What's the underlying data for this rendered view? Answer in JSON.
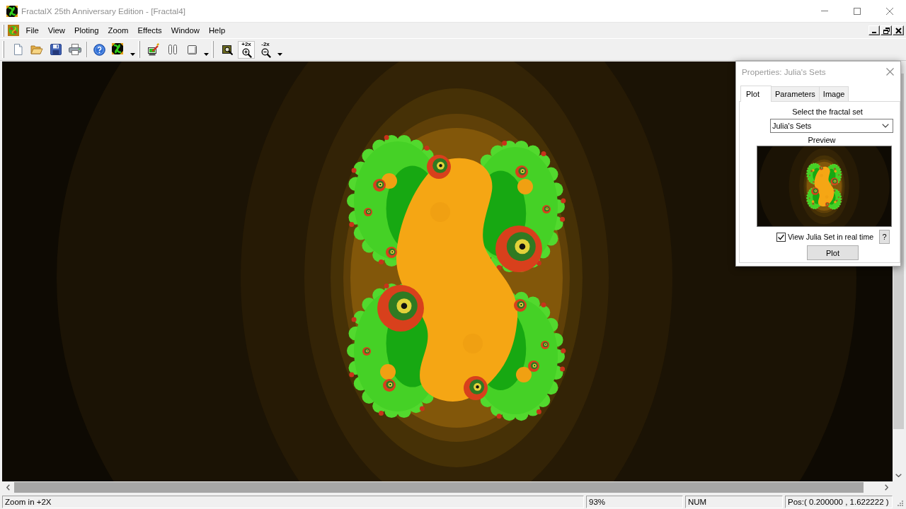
{
  "window": {
    "title": "FractalX 25th Anniversary Edition - [Fractal4]"
  },
  "menu": [
    "File",
    "View",
    "Ploting",
    "Zoom",
    "Effects",
    "Window",
    "Help"
  ],
  "toolbar": [
    [
      [
        {
          "kind": "new",
          "selected": false
        },
        {
          "kind": "open",
          "selected": false
        },
        {
          "kind": "save",
          "selected": false
        },
        {
          "kind": "print",
          "selected": false
        }
      ],
      [
        {
          "kind": "help",
          "selected": false
        },
        {
          "kind": "fractal",
          "selected": false
        },
        {
          "kind": "dropdown",
          "selected": false
        }
      ]
    ],
    [
      [
        {
          "kind": "plot",
          "selected": false
        },
        {
          "kind": "pause",
          "selected": false
        },
        {
          "kind": "stop",
          "selected": false
        },
        {
          "kind": "dropdown",
          "selected": false
        }
      ]
    ],
    [
      [
        {
          "kind": "zoombox",
          "selected": false
        },
        {
          "kind": "zoomin",
          "label": "+2x",
          "selected": true
        },
        {
          "kind": "zoomout",
          "label": "-2x",
          "selected": false
        },
        {
          "kind": "dropdown",
          "selected": false
        }
      ]
    ]
  ],
  "properties": {
    "title": "Properties: Julia's Sets",
    "tabs": [
      {
        "label": "Plot",
        "selected": true
      },
      {
        "label": "Parameters",
        "selected": false
      },
      {
        "label": "Image",
        "selected": false
      }
    ],
    "set_label": "Select the fractal set",
    "set_value": "Julia's Sets",
    "preview_label": "Preview",
    "realtime": {
      "label": "View Julia Set in real time",
      "checked": true
    },
    "help_button": "?",
    "plot_button": "Plot"
  },
  "status_bar": [
    "Zoom in +2X",
    "93%",
    "NUM",
    "Pos:( 0.200000 , 1.622222 )"
  ]
}
